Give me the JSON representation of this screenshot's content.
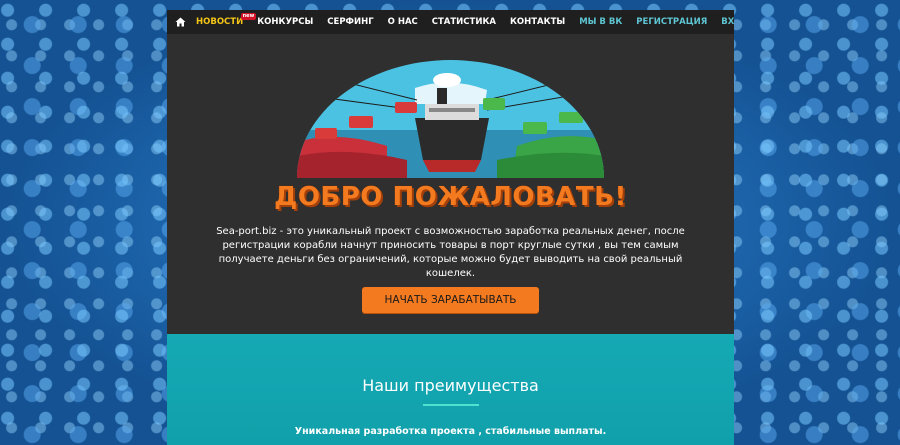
{
  "nav": {
    "items": [
      {
        "label": "НОВОСТИ",
        "badge": "new"
      },
      {
        "label": "КОНКУРСЫ"
      },
      {
        "label": "СЕРФИНГ"
      },
      {
        "label": "О НАС"
      },
      {
        "label": "СТАТИСТИКА"
      },
      {
        "label": "КОНТАКТЫ"
      },
      {
        "label": "МЫ В ВК"
      }
    ],
    "right": {
      "register": "РЕГИСТРАЦИЯ",
      "login": "ВХОД"
    }
  },
  "hero": {
    "title": "ДОБРО ПОЖАЛОВАТЬ!",
    "description": "Sea-port.biz - это уникальный проект с возможностью заработка реальных денег, после регистрации корабли начнут приносить товары в порт круглые сутки , вы тем самым получаете деньги без ограничений, которые можно будет выводить на свой реальный кошелек.",
    "button": "НАЧАТЬ ЗАРАБАТЫВАТЬ"
  },
  "advantages": {
    "title": "Наши преимущества",
    "text": "Уникальная разработка проекта , стабильные выплаты."
  },
  "colors": {
    "accent": "#f47a20",
    "teal": "#15a9b4",
    "nav_bg": "#1f1f1f",
    "panel_bg": "#2f2f2f"
  },
  "icons": {
    "home": "home-icon"
  }
}
